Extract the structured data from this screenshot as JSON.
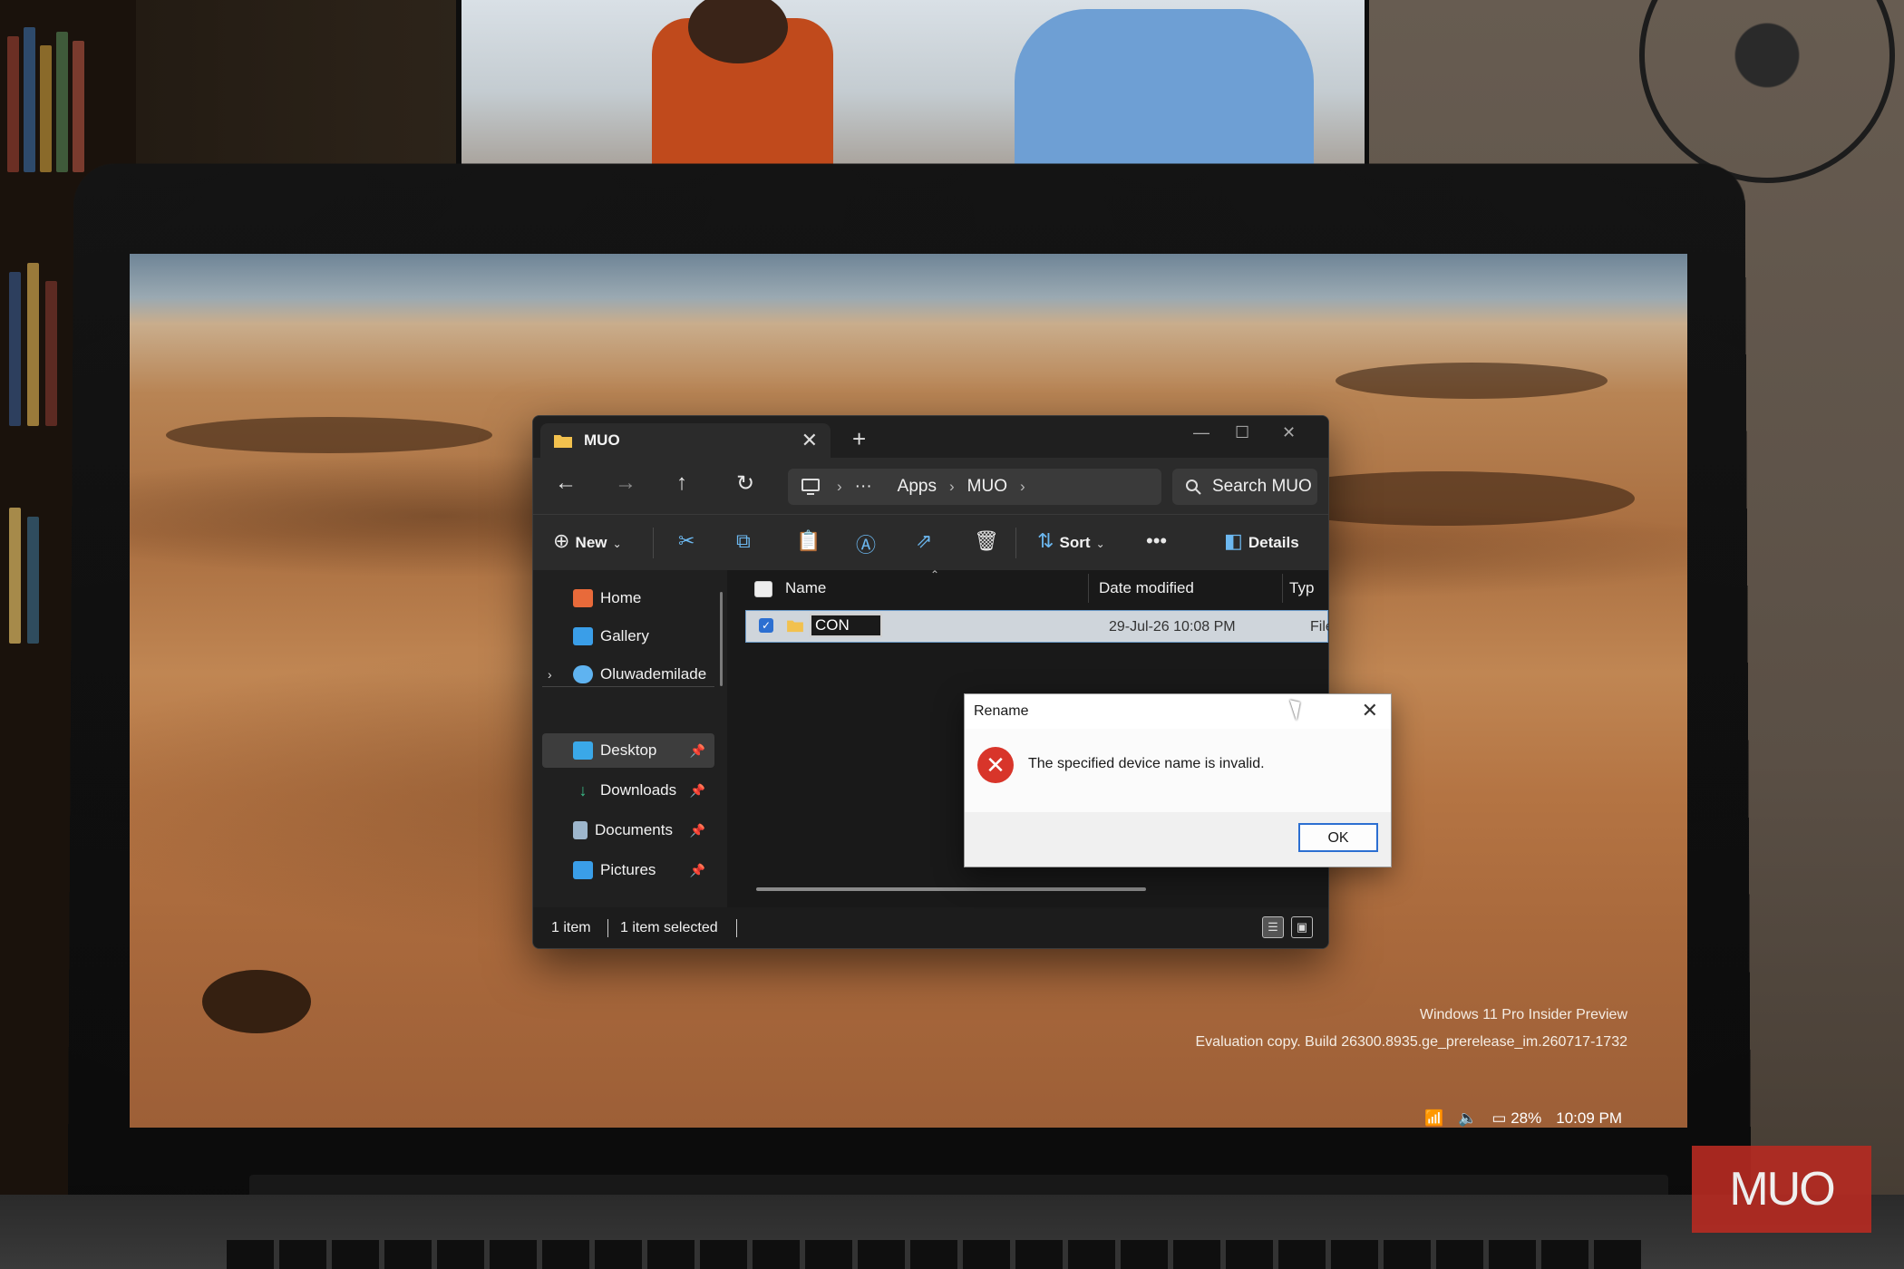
{
  "explorer": {
    "tab_title": "MUO",
    "new_tab": "+",
    "address": {
      "ellipsis": "···",
      "crumbs": [
        "Apps",
        "MUO"
      ]
    },
    "search_placeholder": "Search MUO",
    "toolbar": {
      "new_label": "New",
      "sort_label": "Sort",
      "more": "•••",
      "details_label": "Details"
    },
    "sidebar": {
      "items": [
        {
          "label": "Home"
        },
        {
          "label": "Gallery"
        },
        {
          "label": "Oluwademilade"
        },
        {
          "label": "Desktop"
        },
        {
          "label": "Downloads"
        },
        {
          "label": "Documents"
        },
        {
          "label": "Pictures"
        }
      ]
    },
    "columns": {
      "name": "Name",
      "date_modified": "Date modified",
      "type": "Typ"
    },
    "row": {
      "name": "CON",
      "date": "29-Jul-26 10:08 PM",
      "type": "File"
    },
    "status": {
      "count": "1 item",
      "selected": "1 item selected"
    }
  },
  "dialog": {
    "title": "Rename",
    "message": "The specified device name is invalid.",
    "ok": "OK"
  },
  "desktop": {
    "watermark_line1": "Windows 11 Pro Insider Preview",
    "watermark_line2": "Evaluation copy. Build 26300.8935.ge_prerelease_im.260717-1732"
  },
  "taskbar": {
    "battery": "28%",
    "time": "10:09 PM"
  },
  "brand_watermark": "MUO",
  "colors": {
    "accent": "#2c6fd1",
    "error": "#d8352a",
    "folder": "#f2c14e"
  }
}
